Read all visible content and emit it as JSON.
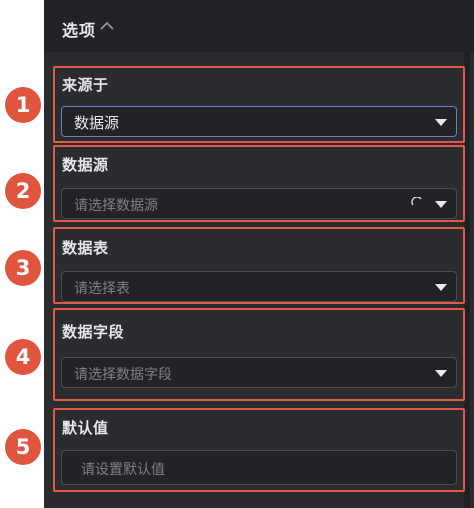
{
  "header": {
    "title": "选项",
    "chevron_icon": "chevron-up-icon"
  },
  "sections": [
    {
      "label": "来源于",
      "value": "数据源"
    },
    {
      "label": "数据源",
      "placeholder": "请选择数据源"
    },
    {
      "label": "数据表",
      "placeholder": "请选择表"
    },
    {
      "label": "数据字段",
      "placeholder": "请选择数据字段"
    },
    {
      "label": "默认值",
      "placeholder": "请设置默认值"
    }
  ],
  "badges": [
    "1",
    "2",
    "3",
    "4",
    "5"
  ],
  "colors": {
    "panel_bg": "#2b2c30",
    "header_bg": "#222327",
    "field_bg": "#222327",
    "highlight": "#e05a45",
    "badge": "#e1553f",
    "focus_border": "#6d7ec9"
  }
}
